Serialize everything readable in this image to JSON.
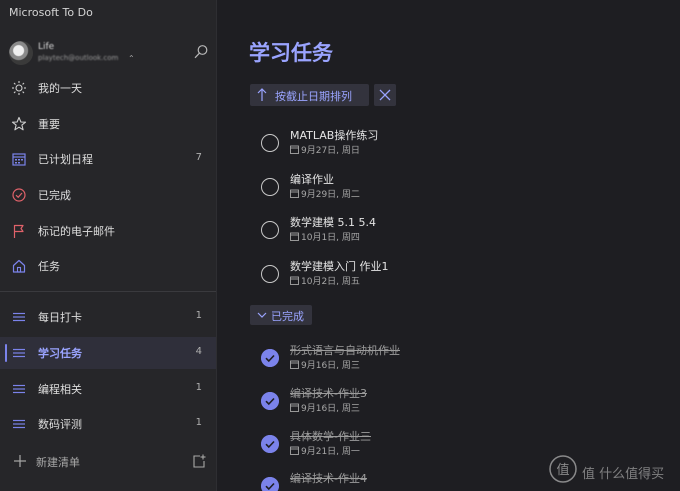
{
  "app": {
    "title": "Microsoft To Do"
  },
  "profile": {
    "name": "Life",
    "email": "playtech@outlook.com"
  },
  "nav": [
    {
      "id": "my-day",
      "label": "我的一天",
      "count": "",
      "icon": "sun-icon"
    },
    {
      "id": "important",
      "label": "重要",
      "count": "",
      "icon": "star-icon"
    },
    {
      "id": "planned",
      "label": "已计划日程",
      "count": "7",
      "icon": "calendar-icon"
    },
    {
      "id": "completed",
      "label": "已完成",
      "count": "",
      "icon": "check-circle-icon"
    },
    {
      "id": "flagged-email",
      "label": "标记的电子邮件",
      "count": "",
      "icon": "flag-icon"
    },
    {
      "id": "tasks",
      "label": "任务",
      "count": "",
      "icon": "home-icon"
    }
  ],
  "lists": [
    {
      "id": "daily-checkin",
      "label": "每日打卡",
      "count": "1",
      "active": false
    },
    {
      "id": "study-tasks",
      "label": "学习任务",
      "count": "4",
      "active": true
    },
    {
      "id": "programming",
      "label": "编程相关",
      "count": "1",
      "active": false
    },
    {
      "id": "digital-review",
      "label": "数码评测",
      "count": "1",
      "active": false
    }
  ],
  "new_list": {
    "label": "新建清单"
  },
  "main": {
    "title": "学习任务",
    "sort_label": "按截止日期排列",
    "completed_label": "已完成",
    "tasks": [
      {
        "title": "MATLAB操作练习",
        "due": "9月27日, 周日"
      },
      {
        "title": "编译作业",
        "due": "9月29日, 周二"
      },
      {
        "title": "数学建模 5.1 5.4",
        "due": "10月1日, 周四"
      },
      {
        "title": "数学建模入门 作业1",
        "due": "10月2日, 周五"
      }
    ],
    "completed_tasks": [
      {
        "title": "形式语言与自动机作业",
        "due": "9月16日, 周三"
      },
      {
        "title": "编译技术-作业3",
        "due": "9月16日, 周三"
      },
      {
        "title": "具体数学-作业三",
        "due": "9月21日, 周一"
      },
      {
        "title": "编译技术-作业4",
        "due": ""
      }
    ]
  },
  "watermark": {
    "text": "值 什么值得买"
  },
  "colors": {
    "accent": "#7b83eb",
    "accent_text": "#9aa4ff",
    "sidebar_bg": "#262629",
    "main_bg": "#1e1e22"
  }
}
